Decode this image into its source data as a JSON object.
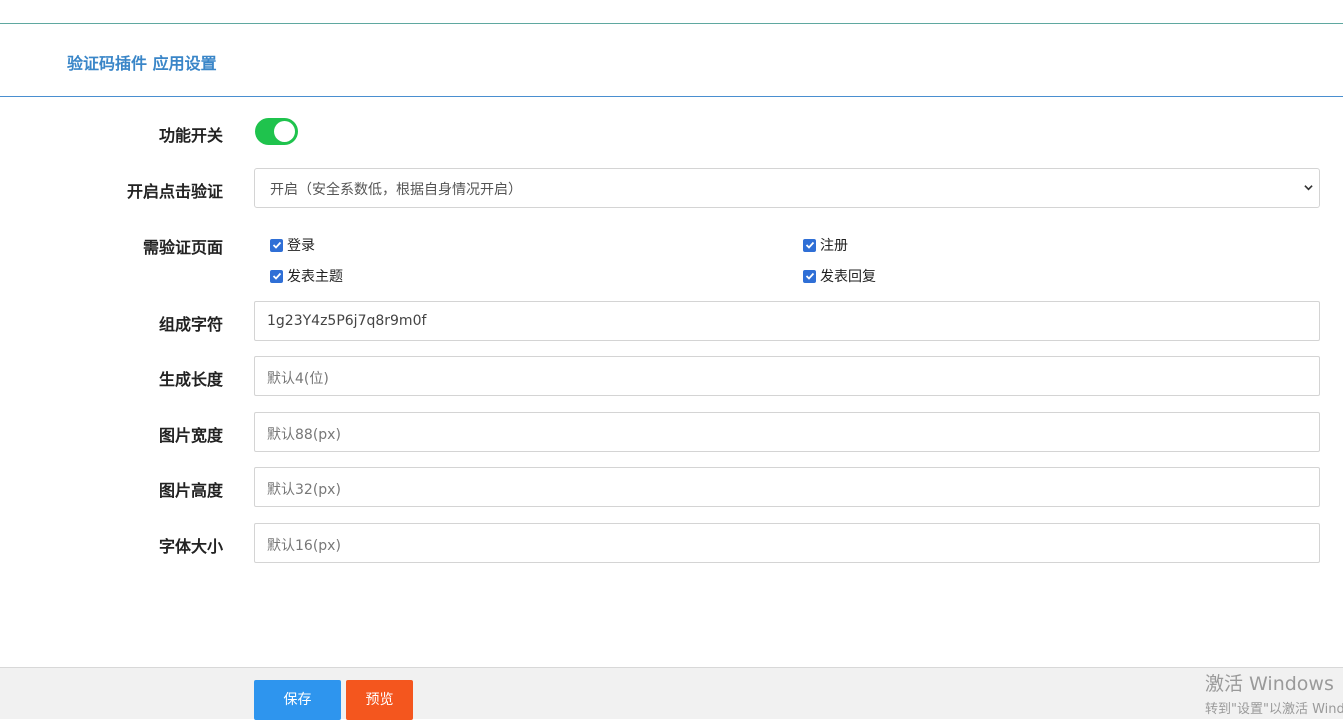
{
  "header": {
    "title": "验证码插件 应用设置"
  },
  "form": {
    "feature_switch": {
      "label": "功能开关",
      "enabled": true
    },
    "click_verify": {
      "label": "开启点击验证",
      "selected": "开启（安全系数低，根据自身情况开启）"
    },
    "verify_pages": {
      "label": "需验证页面",
      "options": [
        {
          "label": "登录",
          "checked": true
        },
        {
          "label": "注册",
          "checked": true
        },
        {
          "label": "发表主题",
          "checked": true
        },
        {
          "label": "发表回复",
          "checked": true
        }
      ]
    },
    "charset": {
      "label": "组成字符",
      "value": "1g23Y4z5P6j7q8r9m0f"
    },
    "length": {
      "label": "生成长度",
      "placeholder": "默认4(位)"
    },
    "img_width": {
      "label": "图片宽度",
      "placeholder": "默认88(px)"
    },
    "img_height": {
      "label": "图片高度",
      "placeholder": "默认32(px)"
    },
    "font_size": {
      "label": "字体大小",
      "placeholder": "默认16(px)"
    }
  },
  "footer": {
    "save_label": "保存",
    "preview_label": "预览"
  },
  "watermark": {
    "line1": "激活 Windows",
    "line2": "转到\"设置\"以激活 Windows。"
  },
  "colors": {
    "accent": "#3a86c8",
    "toggle_on": "#1fc34d",
    "save": "#2e95ee",
    "preview": "#f4561e"
  }
}
